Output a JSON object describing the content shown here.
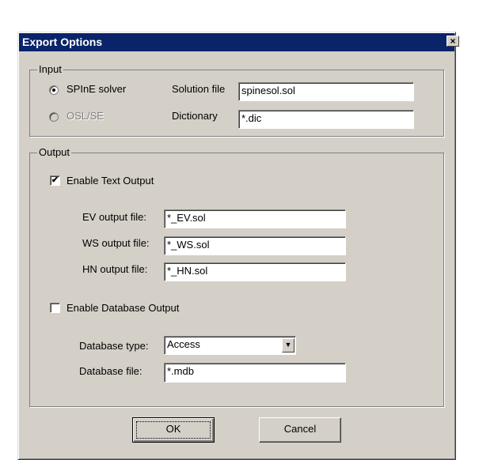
{
  "window": {
    "title": "Export Options",
    "close_glyph": "×"
  },
  "input_group": {
    "label": "Input",
    "radio_spine": {
      "label": "SPInE solver",
      "selected": true
    },
    "radio_osl": {
      "label": "OSL/SE",
      "selected": false,
      "enabled": false
    },
    "solution_file": {
      "label": "Solution file",
      "value": "spinesol.sol"
    },
    "dictionary": {
      "label": "Dictionary",
      "value": "*.dic"
    }
  },
  "output_group": {
    "label": "Output",
    "enable_text": {
      "label": "Enable Text Output",
      "checked": true,
      "check_glyph": "✔"
    },
    "ev_file": {
      "label": "EV output file:",
      "value": "*_EV.sol"
    },
    "ws_file": {
      "label": "WS output file:",
      "value": "*_WS.sol"
    },
    "hn_file": {
      "label": "HN output file:",
      "value": "*_HN.sol"
    },
    "enable_db": {
      "label": "Enable Database Output",
      "checked": false
    },
    "db_type": {
      "label": "Database type:",
      "value": "Access",
      "arrow_glyph": "▼"
    },
    "db_file": {
      "label": "Database file:",
      "value": "*.mdb"
    }
  },
  "buttons": {
    "ok": "OK",
    "cancel": "Cancel"
  }
}
